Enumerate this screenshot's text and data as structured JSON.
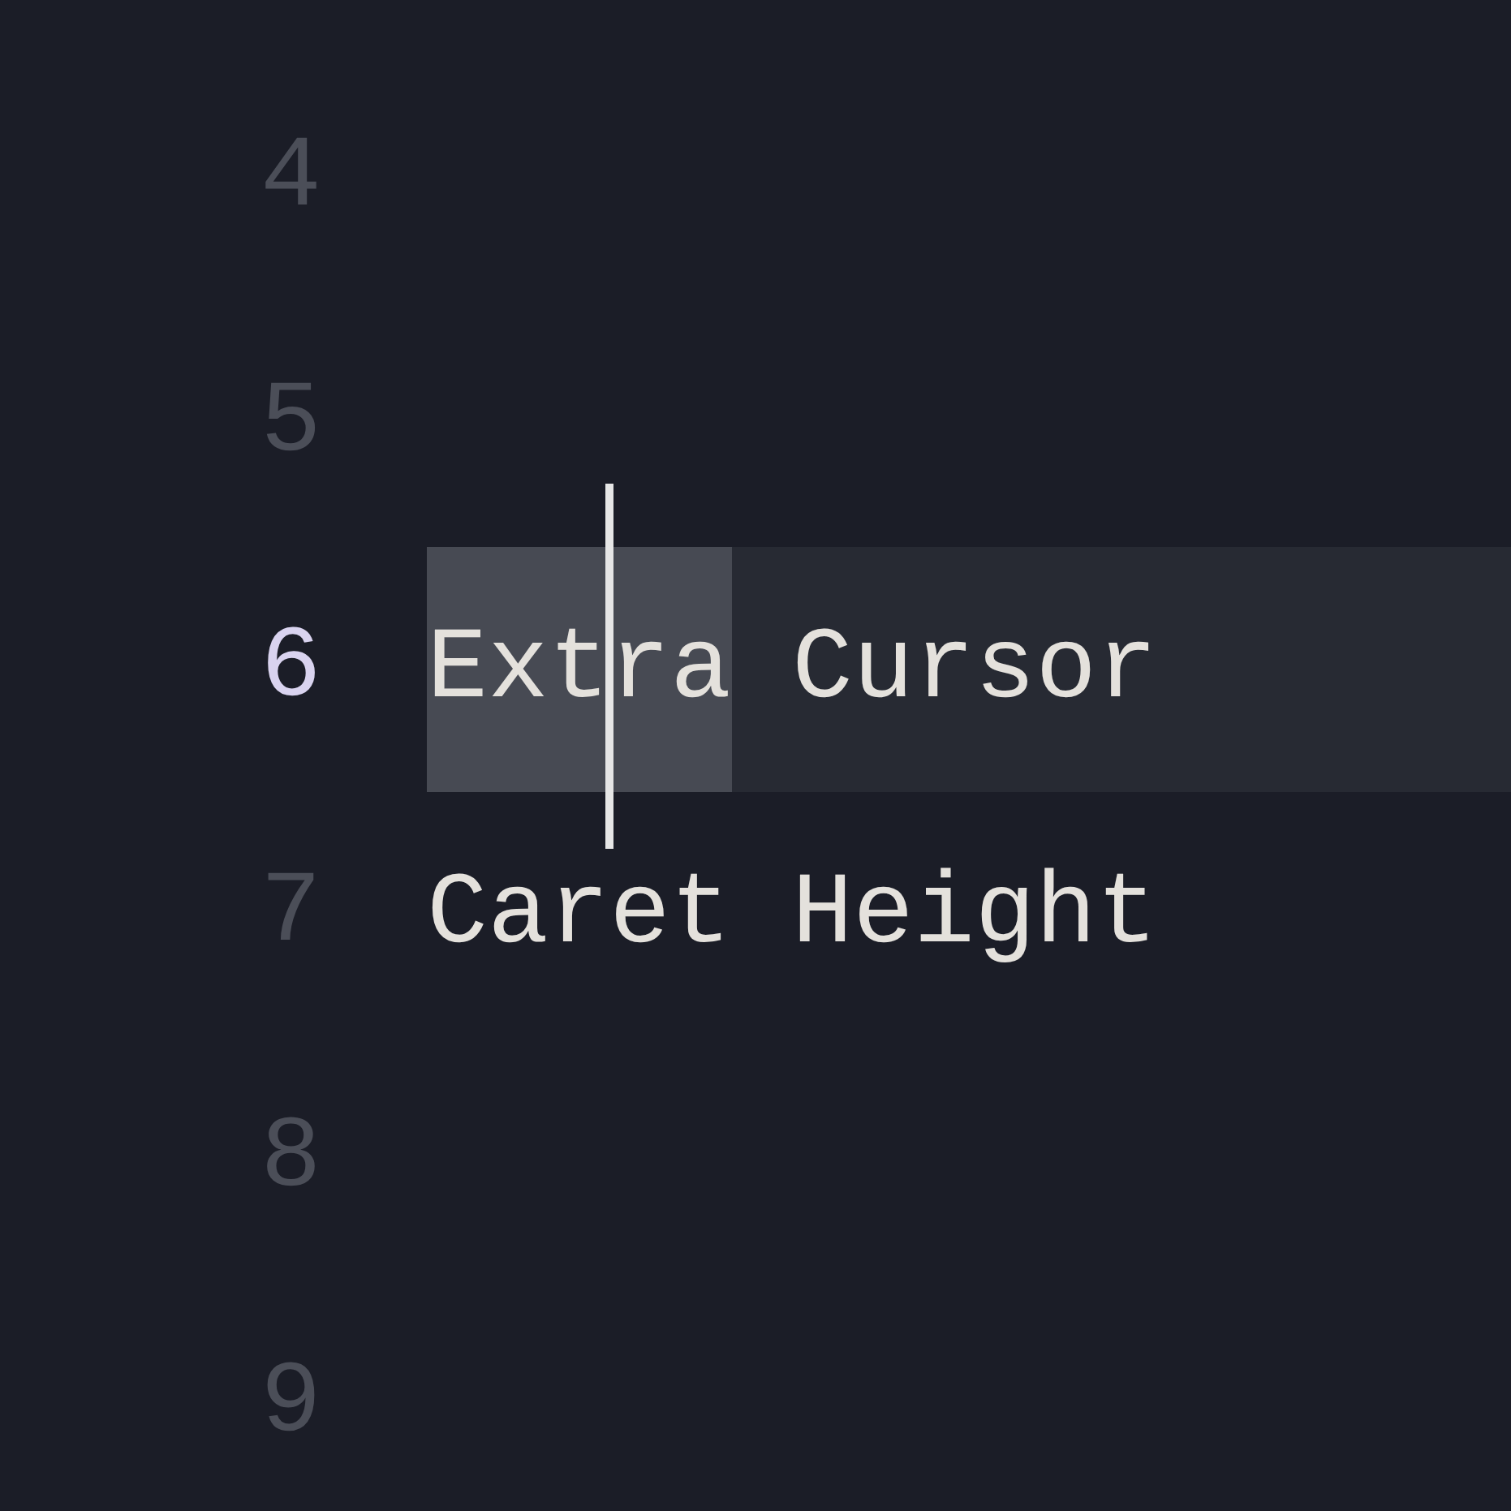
{
  "editor": {
    "lines": [
      {
        "number": "4",
        "current": false
      },
      {
        "number": "5",
        "current": false
      },
      {
        "number": "6",
        "current": true,
        "segments": [
          {
            "text": "Ext",
            "selected": true,
            "caret_after": true
          },
          {
            "text": "ra",
            "selected": true,
            "caret_after": false
          },
          {
            "text": " Cursor",
            "selected": false,
            "caret_after": false
          }
        ]
      },
      {
        "number": "7",
        "current": false,
        "segments": [
          {
            "text": "Caret Height",
            "selected": false,
            "caret_after": false
          }
        ]
      },
      {
        "number": "8",
        "current": false
      },
      {
        "number": "9",
        "current": false
      }
    ]
  }
}
